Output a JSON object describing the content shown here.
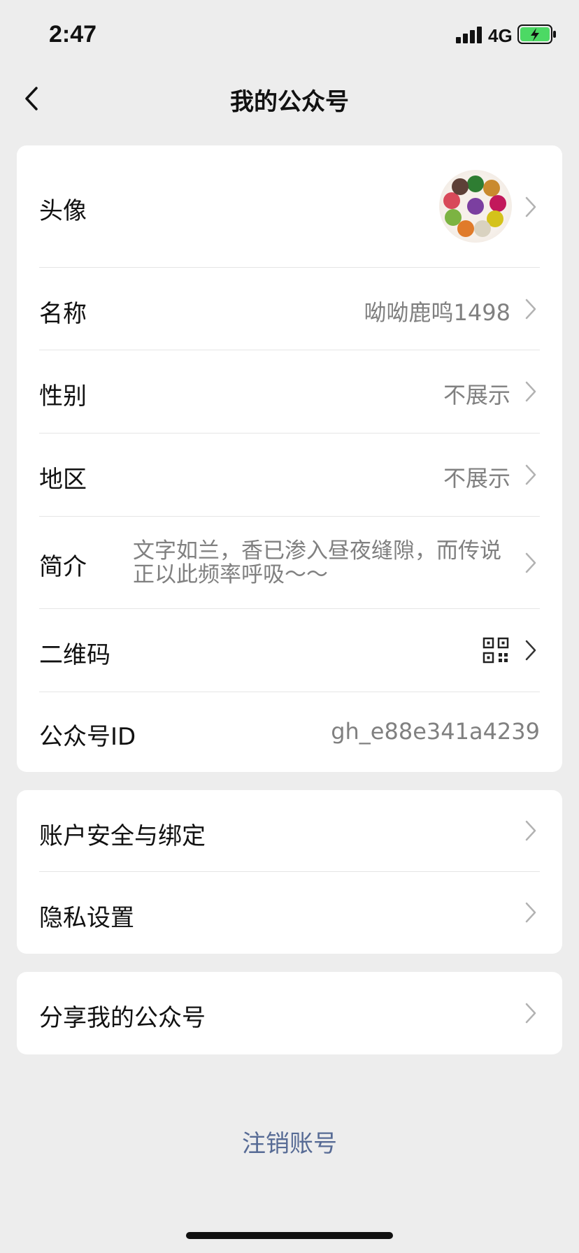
{
  "status": {
    "time": "2:47",
    "network": "4G"
  },
  "nav": {
    "title": "我的公众号"
  },
  "profile": {
    "avatar_label": "头像",
    "name_label": "名称",
    "name_value": "呦呦鹿鸣1498",
    "gender_label": "性别",
    "gender_value": "不展示",
    "region_label": "地区",
    "region_value": "不展示",
    "intro_label": "简介",
    "intro_value": "文字如兰，香已渗入昼夜缝隙，而传说正以此频率呼吸～～",
    "qrcode_label": "二维码",
    "id_label": "公众号ID",
    "id_value": "gh_e88e341a4239"
  },
  "account": {
    "security_label": "账户安全与绑定",
    "privacy_label": "隐私设置"
  },
  "share": {
    "label": "分享我的公众号"
  },
  "logout": {
    "label": "注销账号"
  },
  "colors": {
    "background": "#ededed",
    "card": "#ffffff",
    "secondary_text": "#808080",
    "link": "#576b95",
    "battery_fill": "#4cd964"
  }
}
